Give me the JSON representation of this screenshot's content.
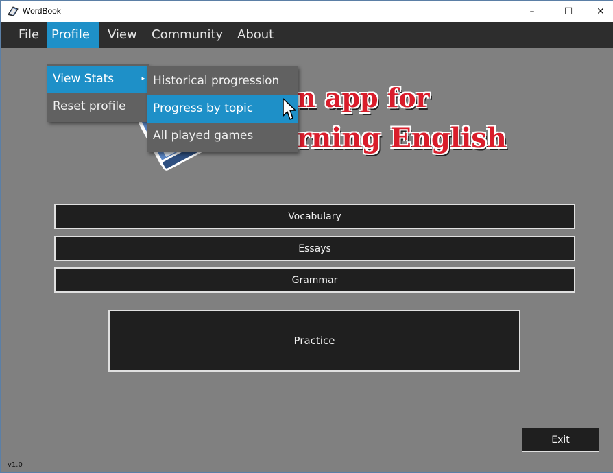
{
  "window": {
    "title": "WordBook",
    "app_icon": "book-icon"
  },
  "window_controls": {
    "minimize": "–",
    "maximize": "☐",
    "close": "✕"
  },
  "menubar": {
    "items": [
      {
        "label": "File"
      },
      {
        "label": "Profile",
        "active": true
      },
      {
        "label": "View"
      },
      {
        "label": "Community"
      },
      {
        "label": "About"
      }
    ]
  },
  "profile_menu": {
    "items": [
      {
        "label": "View Stats",
        "active": true,
        "has_submenu": true
      },
      {
        "label": "Reset profile"
      }
    ]
  },
  "view_stats_submenu": {
    "items": [
      {
        "label": "Historical progression"
      },
      {
        "label": "Progress by topic",
        "active": true
      },
      {
        "label": "All played games"
      }
    ]
  },
  "banner": {
    "line1_visible": "n app for",
    "line2_visible": "rning English"
  },
  "buttons": {
    "vocabulary": "Vocabulary",
    "essays": "Essays",
    "grammar": "Grammar",
    "practice": "Practice",
    "exit": "Exit"
  },
  "version": "v1.0",
  "colors": {
    "accent": "#1e90c8",
    "background": "#808080",
    "menubar": "#2d2d2d",
    "button": "#1f1f1f",
    "banner_text": "#d91d2b"
  }
}
